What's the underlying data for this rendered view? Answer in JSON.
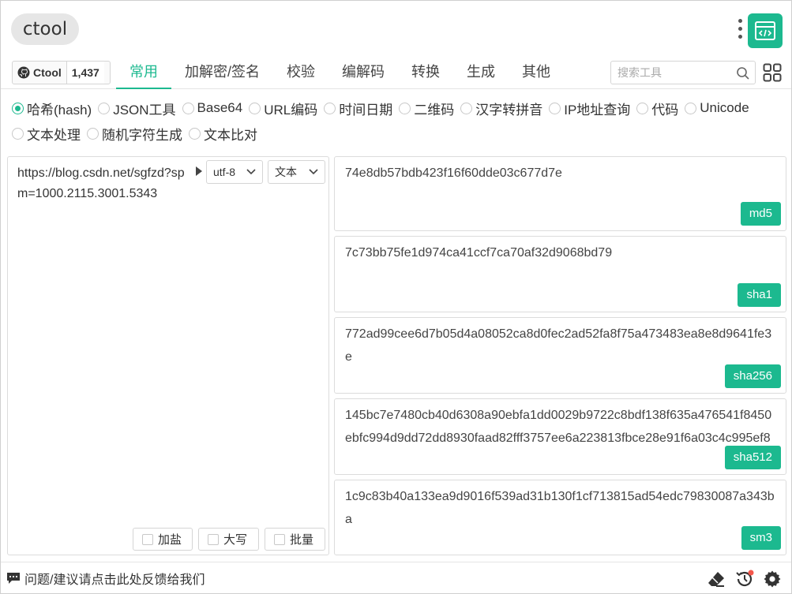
{
  "header": {
    "brand": "ctool"
  },
  "nav": {
    "github": {
      "label": "Ctool",
      "stars": "1,437"
    },
    "tabs": [
      {
        "label": "常用",
        "active": true
      },
      {
        "label": "加解密/签名"
      },
      {
        "label": "校验"
      },
      {
        "label": "编解码"
      },
      {
        "label": "转换"
      },
      {
        "label": "生成"
      },
      {
        "label": "其他"
      }
    ],
    "search_placeholder": "搜索工具"
  },
  "tools": {
    "row1": [
      "哈希(hash)",
      "JSON工具",
      "Base64",
      "URL编码",
      "时间日期",
      "二维码",
      "汉字转拼音",
      "IP地址查询",
      "代码",
      "Unicode"
    ],
    "row2": [
      "文本处理",
      "随机字符生成",
      "文本比对"
    ],
    "selected": "哈希(hash)"
  },
  "input": {
    "text": "https://blog.csdn.net/sgfzd?spm=1000.2115.3001.5343",
    "encoding": "utf-8",
    "type": "文本",
    "options": [
      "加盐",
      "大写",
      "批量"
    ]
  },
  "results": [
    {
      "value": "74e8db57bdb423f16f60dde03c677d7e",
      "label": "md5"
    },
    {
      "value": "7c73bb75fe1d974ca41ccf7ca70af32d9068bd79",
      "label": "sha1"
    },
    {
      "value": "772ad99cee6d7b05d4a08052ca8d0fec2ad52fa8f75a473483ea8e8d9641fe3e",
      "label": "sha256"
    },
    {
      "value": "145bc7e7480cb40d6308a90ebfa1dd0029b9722c8bdf138f635a476541f8450ebfc994d9dd72dd8930faad82fff3757ee6a223813fbce28e91f6a03c4c995ef8",
      "label": "sha512"
    },
    {
      "value": "1c9c83b40a133ea9d9016f539ad31b130f1cf713815ad54edc79830087a343ba",
      "label": "sm3"
    }
  ],
  "footer": {
    "feedback": "问题/建议请点击此处反馈给我们"
  },
  "colors": {
    "accent": "#1cb98f",
    "badge": "#f4574b"
  }
}
